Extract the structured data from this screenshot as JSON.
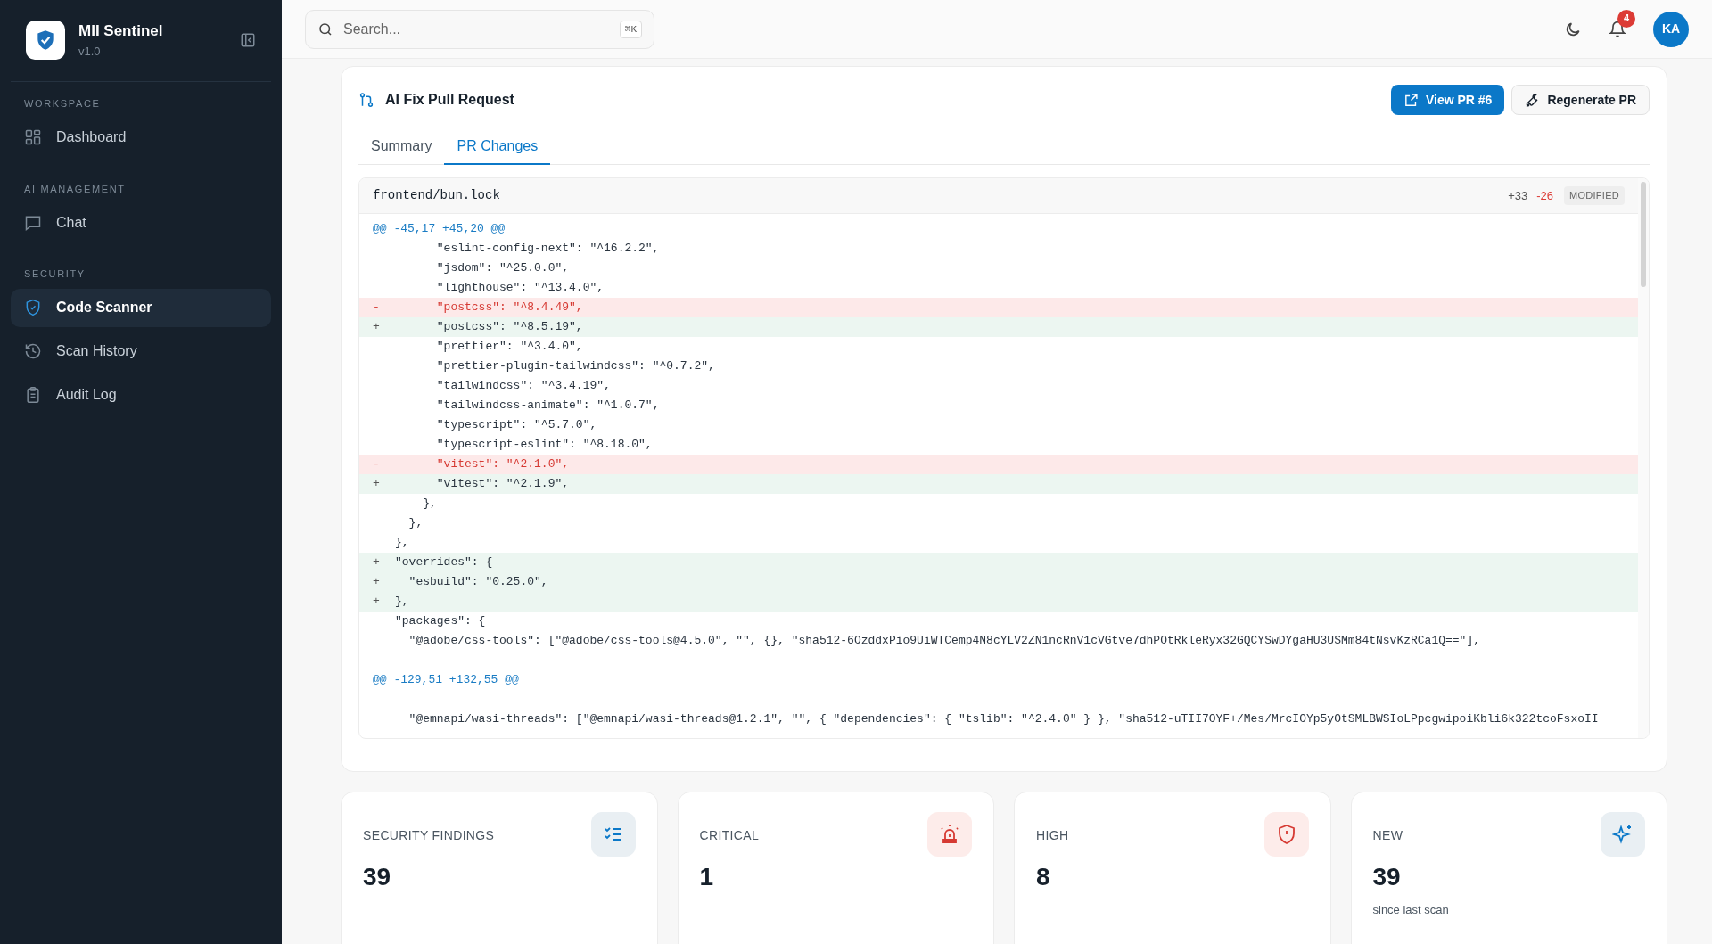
{
  "sidebar": {
    "app_name": "MII Sentinel",
    "version": "v1.0",
    "sections": [
      {
        "title": "WORKSPACE",
        "items": [
          {
            "label": "Dashboard",
            "selected": false
          }
        ]
      },
      {
        "title": "AI MANAGEMENT",
        "items": [
          {
            "label": "Chat",
            "selected": false
          }
        ]
      },
      {
        "title": "SECURITY",
        "items": [
          {
            "label": "Code Scanner",
            "selected": true
          },
          {
            "label": "Scan History",
            "selected": false
          },
          {
            "label": "Audit Log",
            "selected": false
          }
        ]
      }
    ]
  },
  "header": {
    "search": {
      "placeholder": "Search...",
      "shortcut": "⌘K"
    },
    "notifications": "4",
    "avatar": "KA"
  },
  "pr_panel": {
    "title": "AI Fix Pull Request",
    "buttons": [
      {
        "label": "View PR #6",
        "kind": "primary"
      },
      {
        "label": "Regenerate PR",
        "kind": "secondary"
      }
    ],
    "tabs": [
      {
        "label": "Summary",
        "selected": false
      },
      {
        "label": "PR Changes",
        "selected": true
      }
    ],
    "file": {
      "path": "frontend/bun.lock",
      "additions": "+33",
      "deletions": "-26",
      "status": "MODIFIED"
    },
    "lines": [
      {
        "kind": "hunk",
        "text": "@@ -45,17 +45,20 @@"
      },
      {
        "kind": "context",
        "text": "      \"eslint-config-next\": \"^16.2.2\","
      },
      {
        "kind": "context",
        "text": "      \"jsdom\": \"^25.0.0\","
      },
      {
        "kind": "context",
        "text": "      \"lighthouse\": \"^13.4.0\","
      },
      {
        "kind": "del",
        "sign": "-",
        "text": "      \"postcss\": \"^8.4.49\","
      },
      {
        "kind": "add",
        "sign": "+",
        "text": "      \"postcss\": \"^8.5.19\","
      },
      {
        "kind": "context",
        "text": "      \"prettier\": \"^3.4.0\","
      },
      {
        "kind": "context",
        "text": "      \"prettier-plugin-tailwindcss\": \"^0.7.2\","
      },
      {
        "kind": "context",
        "text": "      \"tailwindcss\": \"^3.4.19\","
      },
      {
        "kind": "context",
        "text": "      \"tailwindcss-animate\": \"^1.0.7\","
      },
      {
        "kind": "context",
        "text": "      \"typescript\": \"^5.7.0\","
      },
      {
        "kind": "context",
        "text": "      \"typescript-eslint\": \"^8.18.0\","
      },
      {
        "kind": "del",
        "sign": "-",
        "text": "      \"vitest\": \"^2.1.0\","
      },
      {
        "kind": "add",
        "sign": "+",
        "text": "      \"vitest\": \"^2.1.9\","
      },
      {
        "kind": "context",
        "text": "    },"
      },
      {
        "kind": "context",
        "text": "  },"
      },
      {
        "kind": "context",
        "text": "},"
      },
      {
        "kind": "add",
        "sign": "+",
        "text": "\"overrides\": {"
      },
      {
        "kind": "add",
        "sign": "+",
        "text": "  \"esbuild\": \"0.25.0\","
      },
      {
        "kind": "add",
        "sign": "+",
        "text": "},"
      },
      {
        "kind": "context",
        "text": "\"packages\": {"
      },
      {
        "kind": "context",
        "text": "  \"@adobe/css-tools\": [\"@adobe/css-tools@4.5.0\", \"\", {}, \"sha512-6OzddxPio9UiWTCemp4N8cYLV2ZN1ncRnV1cVGtve7dhPOtRkleRyx32GQCYSwDYgaHU3USMm84tNsvKzRCa1Q==\"],"
      },
      {
        "kind": "spacer"
      },
      {
        "kind": "hunk",
        "text": "@@ -129,51 +132,55 @@"
      },
      {
        "kind": "spacer"
      },
      {
        "kind": "context",
        "text": "  \"@emnapi/wasi-threads\": [\"@emnapi/wasi-threads@1.2.1\", \"\", { \"dependencies\": { \"tslib\": \"^2.4.0\" } }, \"sha512-uTII7OYF+/Mes/MrcIOYp5yOtSMLBWSIoLPpcgwipoiKbli6k322tcoFsxoII"
      }
    ]
  },
  "stats": [
    {
      "label": "SECURITY FINDINGS",
      "value": "39"
    },
    {
      "label": "CRITICAL",
      "value": "1"
    },
    {
      "label": "HIGH",
      "value": "8"
    },
    {
      "label": "NEW",
      "value": "39",
      "note": "since last scan"
    }
  ]
}
